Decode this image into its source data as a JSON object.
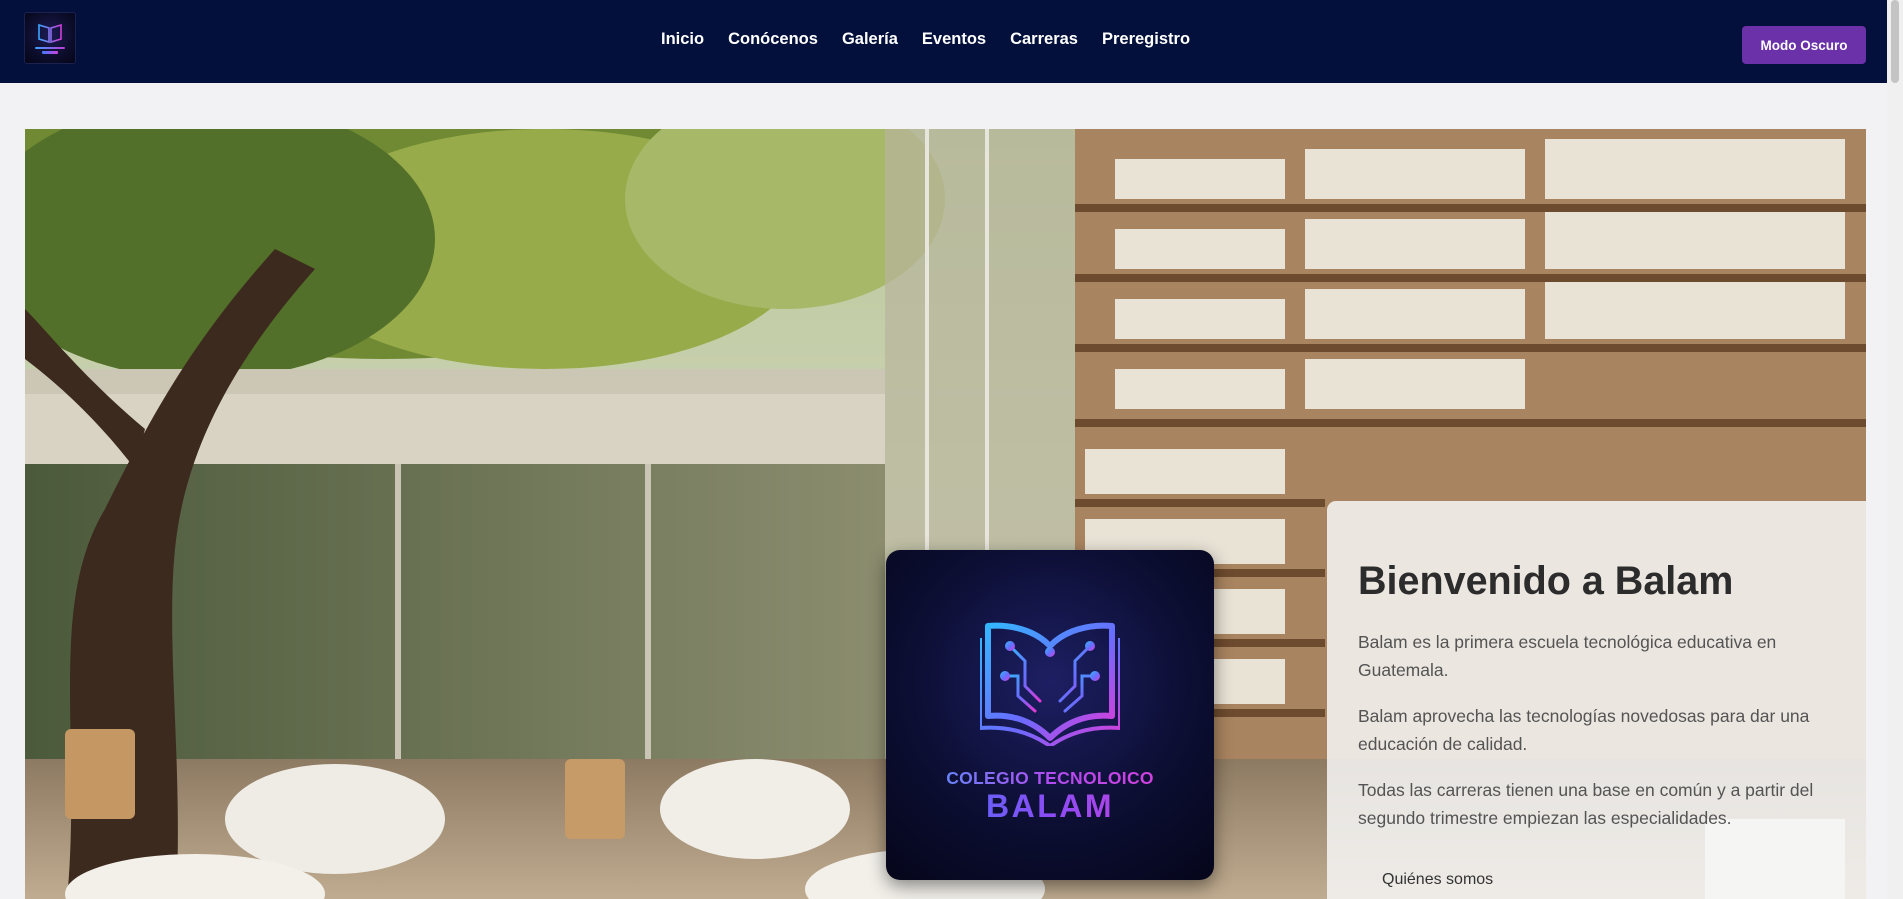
{
  "navbar": {
    "logo_icon": "school-book-logo",
    "links": [
      "Inicio",
      "Conócenos",
      "Galería",
      "Eventos",
      "Carreras",
      "Preregistro"
    ],
    "dark_mode_label": "Modo Oscuro",
    "background_color": "#03103b",
    "dark_mode_color": "#6a31a8"
  },
  "hero": {
    "logo_card": {
      "line1": "COLEGIO TECNOLOICO",
      "line2": "BALAM",
      "icon": "open-book-circuit-icon"
    },
    "welcome": {
      "title": "Bienvenido a Balam",
      "paragraphs": [
        "Balam es la primera escuela tecnológica educativa en Guatemala.",
        "Balam aprovecha las tecnologías novedosas para dar una educación de calidad.",
        "Todas las carreras tienen una base en común y a partir del segundo trimestre empiezan las especialidades."
      ],
      "button_label": "Quiénes somos"
    }
  }
}
